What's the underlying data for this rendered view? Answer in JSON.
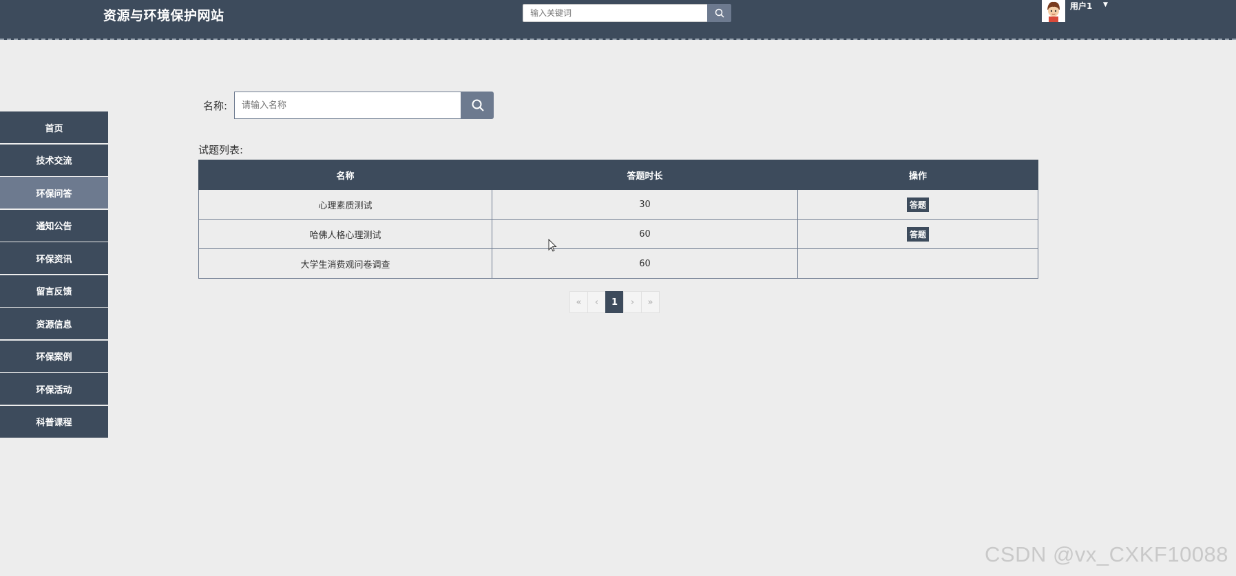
{
  "header": {
    "site_title": "资源与环境保护网站",
    "search_placeholder": "输入关键词",
    "username": "用户1"
  },
  "sidebar": {
    "items": [
      {
        "label": "首页",
        "active": false
      },
      {
        "label": "技术交流",
        "active": false
      },
      {
        "label": "环保问答",
        "active": true
      },
      {
        "label": "通知公告",
        "active": false
      },
      {
        "label": "环保资讯",
        "active": false
      },
      {
        "label": "留言反馈",
        "active": false
      },
      {
        "label": "资源信息",
        "active": false
      },
      {
        "label": "环保案例",
        "active": false
      },
      {
        "label": "环保活动",
        "active": false
      },
      {
        "label": "科普课程",
        "active": false
      }
    ]
  },
  "filter": {
    "name_label": "名称:",
    "name_placeholder": "请输入名称"
  },
  "list": {
    "title": "试题列表:",
    "columns": [
      "名称",
      "答题时长",
      "操作"
    ],
    "rows": [
      {
        "name": "心理素质测试",
        "duration": "30",
        "action": "答题"
      },
      {
        "name": "哈佛人格心理测试",
        "duration": "60",
        "action": "答题"
      },
      {
        "name": "大学生消费观问卷调查",
        "duration": "60",
        "action": ""
      }
    ]
  },
  "pagination": {
    "first": "«",
    "prev": "‹",
    "current": "1",
    "next": "›",
    "last": "»"
  },
  "watermark": "CSDN @vx_CXKF10088",
  "colors": {
    "header_bg": "#3d4b5c",
    "accent": "#6d7a8f",
    "page_bg": "#ededed"
  }
}
